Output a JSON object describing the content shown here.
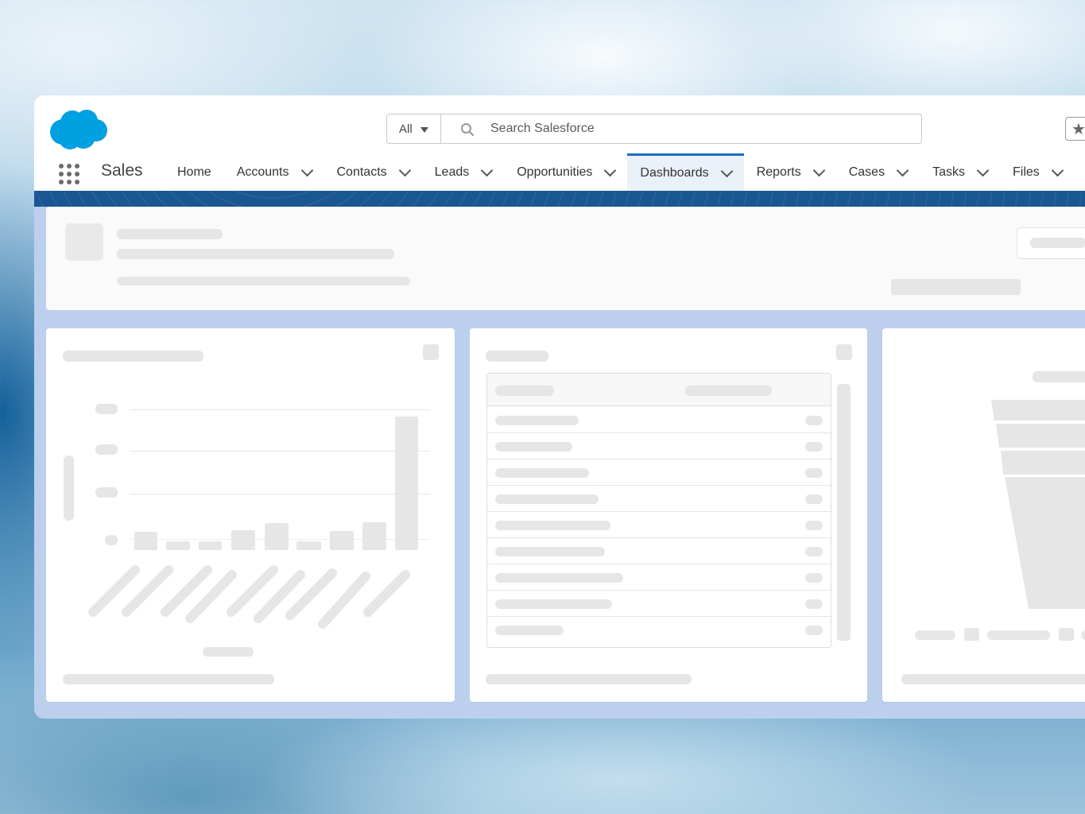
{
  "header": {
    "search_scope": "All",
    "search_placeholder": "Search Salesforce"
  },
  "app_name": "Sales",
  "nav": {
    "items": [
      {
        "label": "Home",
        "has_menu": false
      },
      {
        "label": "Accounts",
        "has_menu": true
      },
      {
        "label": "Contacts",
        "has_menu": true
      },
      {
        "label": "Leads",
        "has_menu": true
      },
      {
        "label": "Opportunities",
        "has_menu": true
      },
      {
        "label": "Dashboards",
        "has_menu": true,
        "active": true
      },
      {
        "label": "Reports",
        "has_menu": true
      },
      {
        "label": "Cases",
        "has_menu": true
      },
      {
        "label": "Tasks",
        "has_menu": true
      },
      {
        "label": "Files",
        "has_menu": true
      }
    ]
  },
  "icons": {
    "logo": "salesforce-cloud-logo",
    "search": "search-icon",
    "favorites": "star-icon",
    "launcher": "app-launcher-grid-icon"
  },
  "colors": {
    "brand_blue": "#00a1e0",
    "active_tab_bar": "#1b6dc1",
    "band": "#1a5692",
    "skeleton": "#e6e6e6"
  }
}
